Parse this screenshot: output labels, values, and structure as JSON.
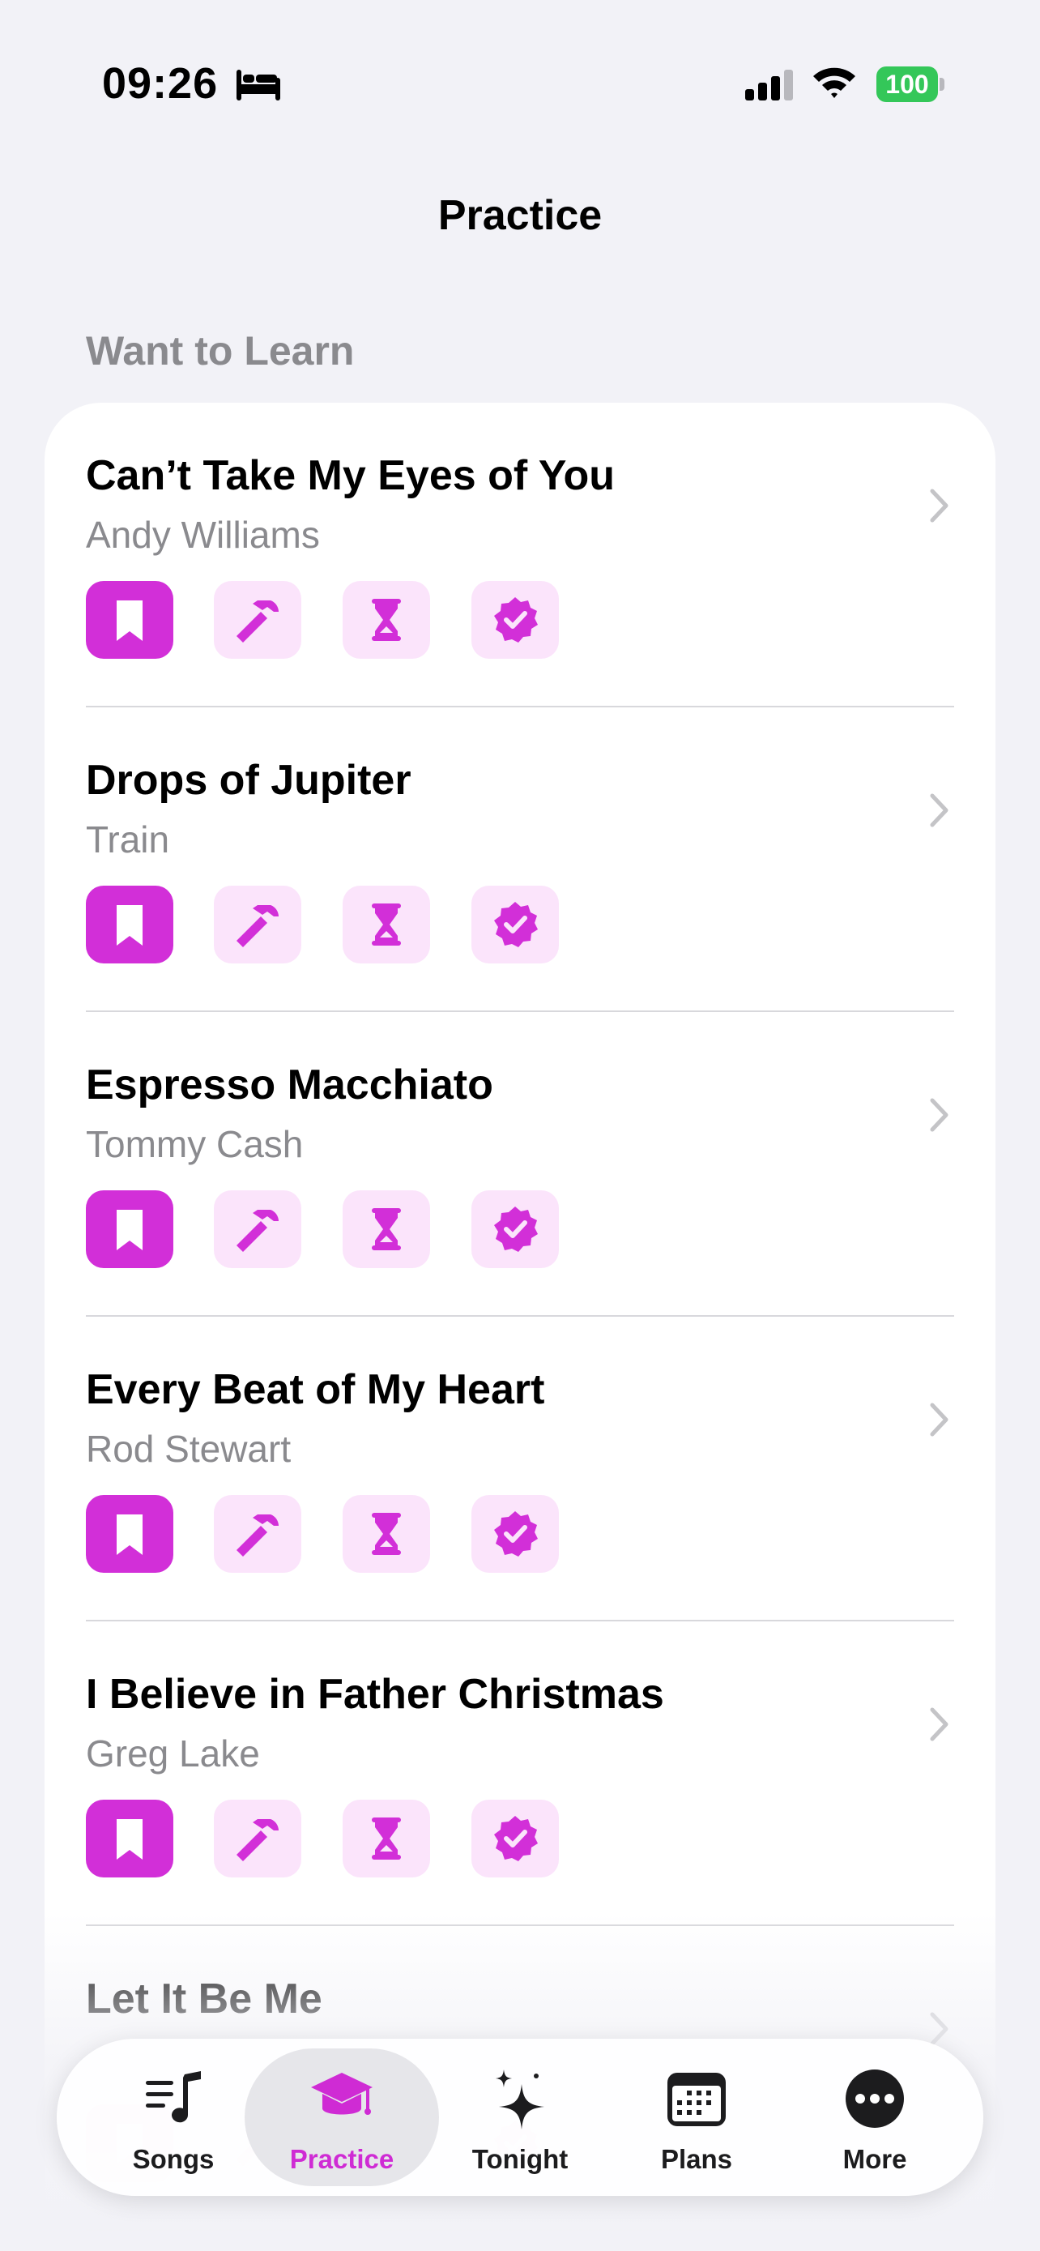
{
  "status_bar": {
    "time": "09:26",
    "battery": "100",
    "icons": [
      "bed-icon",
      "cellular-signal-icon",
      "wifi-icon",
      "battery-icon"
    ]
  },
  "nav": {
    "title": "Practice"
  },
  "section": {
    "header": "Want to Learn"
  },
  "songs": [
    {
      "title": "Can’t Take My Eyes of You",
      "artist": "Andy Williams"
    },
    {
      "title": "Drops of Jupiter",
      "artist": "Train"
    },
    {
      "title": "Espresso Macchiato",
      "artist": "Tommy Cash"
    },
    {
      "title": "Every Beat of My Heart",
      "artist": "Rod Stewart"
    },
    {
      "title": "I Believe in Father Christmas",
      "artist": "Greg Lake"
    },
    {
      "title": "Let It Be Me",
      "artist": ""
    }
  ],
  "status_badges": {
    "icons": [
      "bookmark-icon",
      "hammer-icon",
      "hourglass-icon",
      "checkmark-seal-icon"
    ],
    "active_index": 0
  },
  "tab_bar": {
    "tabs": [
      {
        "label": "Songs",
        "icon": "music-list-icon"
      },
      {
        "label": "Practice",
        "icon": "graduation-cap-icon"
      },
      {
        "label": "Tonight",
        "icon": "sparkles-icon"
      },
      {
        "label": "Plans",
        "icon": "calendar-icon"
      },
      {
        "label": "More",
        "icon": "ellipsis-circle-icon"
      }
    ],
    "selected": "Practice"
  },
  "colors": {
    "accent": "#d22fd8",
    "badge_inactive_bg": "#fbe4fb",
    "background": "#f2f2f7",
    "secondary_text": "#8a8a8e",
    "battery_green": "#34c759"
  }
}
